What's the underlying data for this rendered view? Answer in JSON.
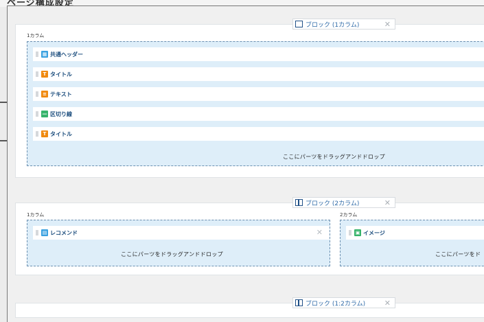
{
  "page": {
    "heading": "ページ構成設定"
  },
  "block1": {
    "tag": "ブロック (1カラム)",
    "columns": [
      {
        "label": "1カラム",
        "rows": [
          {
            "label": "共通ヘッダー",
            "icon": "header-icon",
            "color": "#3aa1e0"
          },
          {
            "label": "タイトル",
            "icon": "title-icon",
            "color": "#f08a10"
          },
          {
            "label": "テキスト",
            "icon": "text-icon",
            "color": "#f08a10"
          },
          {
            "label": "区切り線",
            "icon": "divider-icon",
            "color": "#36b36a"
          },
          {
            "label": "タイトル",
            "icon": "title-icon",
            "color": "#f08a10"
          }
        ],
        "drop": "ここにパーツをドラッグアンドドロップ"
      }
    ]
  },
  "block2": {
    "tag": "ブロック (2カラム)",
    "columns": [
      {
        "label": "1カラム",
        "rows": [
          {
            "label": "レコメンド",
            "icon": "recommend-icon",
            "color": "#3aa1e0"
          }
        ],
        "drop": "ここにパーツをドラッグアンドドロップ"
      },
      {
        "label": "2カラム",
        "rows": [
          {
            "label": "イメージ",
            "icon": "image-icon",
            "color": "#36b36a"
          }
        ],
        "drop": "ここにパーツをド"
      }
    ]
  },
  "block3": {
    "tag": "ブロック (1:2カラム)"
  }
}
